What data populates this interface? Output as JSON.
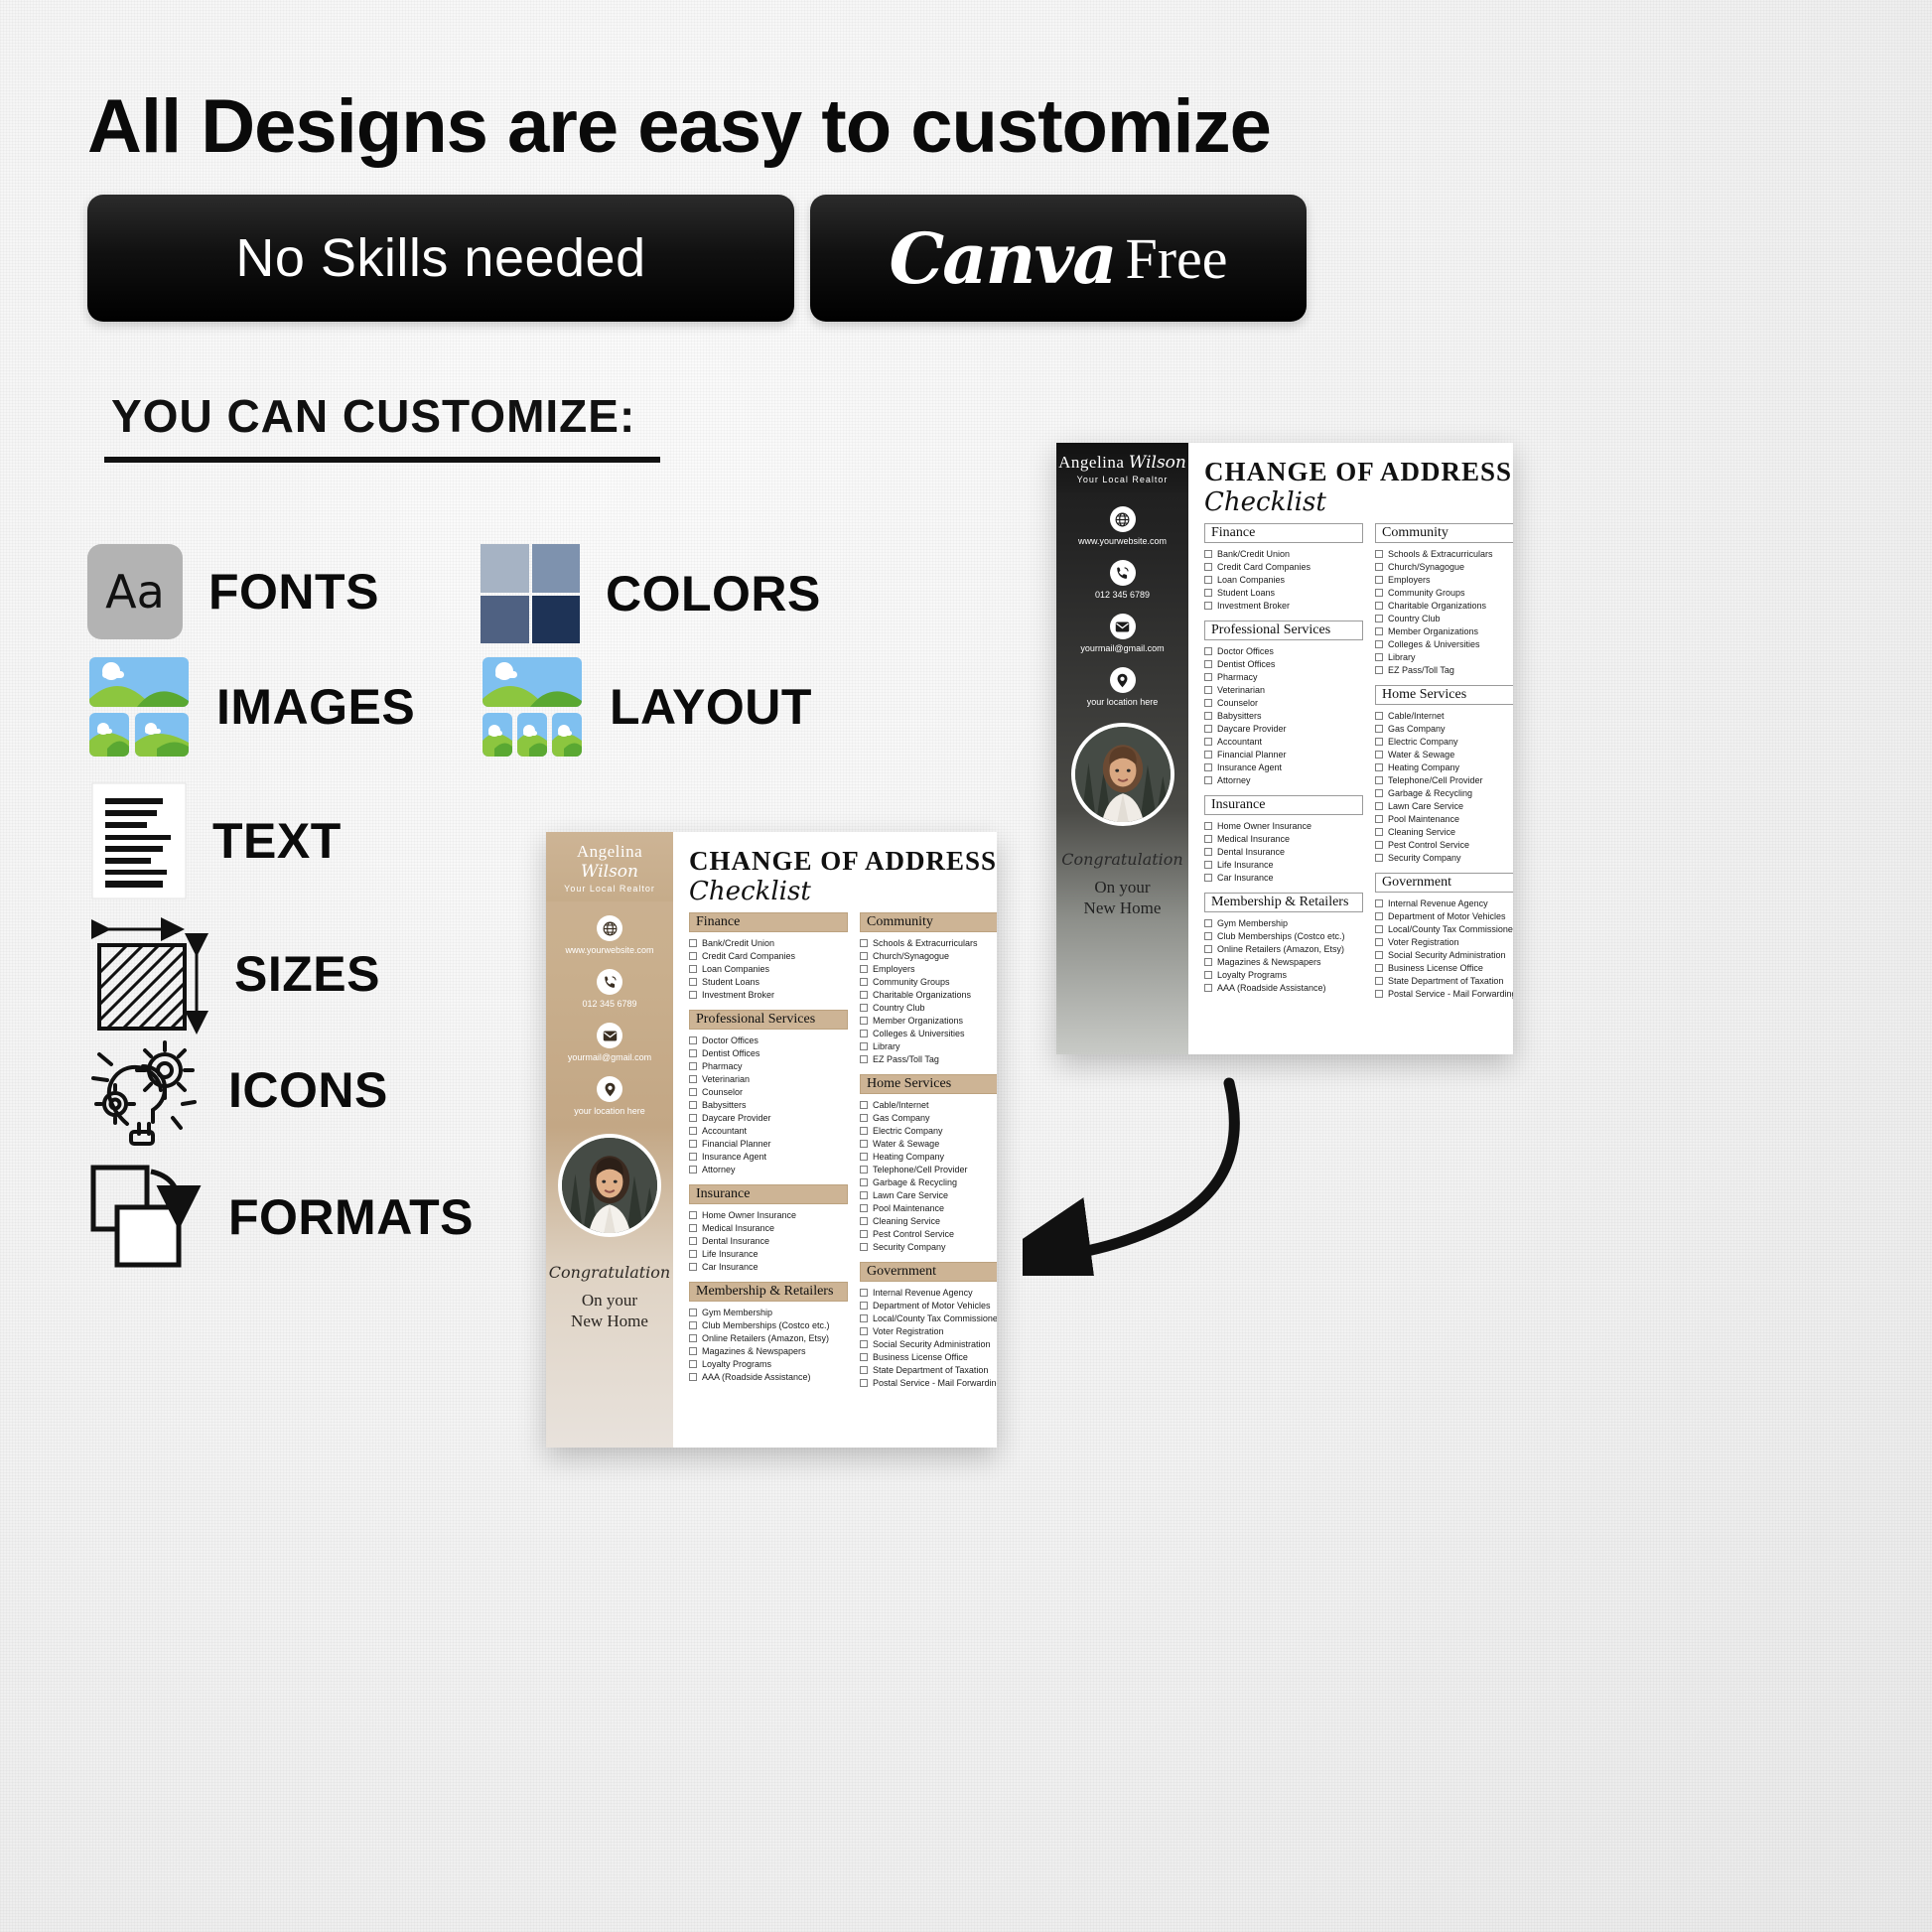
{
  "headline": "All Designs are easy to customize",
  "badges": {
    "no_skills": "No Skills needed",
    "canva_word": "Canva",
    "canva_free": "Free"
  },
  "customize": {
    "heading": "YOU CAN CUSTOMIZE:",
    "features": [
      {
        "label": "FONTS",
        "icon": "fonts-icon",
        "sample": "Aa"
      },
      {
        "label": "COLORS",
        "icon": "colors-swatch-icon"
      },
      {
        "label": "IMAGES",
        "icon": "images-icon"
      },
      {
        "label": "LAYOUT",
        "icon": "layout-icon"
      },
      {
        "label": "TEXT",
        "icon": "text-document-icon"
      },
      {
        "label": "SIZES",
        "icon": "sizes-dimension-icon"
      },
      {
        "label": "ICONS",
        "icon": "lightbulb-gear-icon"
      },
      {
        "label": "FORMATS",
        "icon": "formats-swap-icon"
      }
    ]
  },
  "colors": {
    "swatch": [
      "#a6b3c4",
      "#7e92ae",
      "#4f6182",
      "#1e3356"
    ],
    "fonts_icon_bg": "#b3b3b3",
    "badge_bg": "#000000",
    "flyer_front_accent": "#c6ac8a",
    "flyer_back_accent": "#1e1e1e"
  },
  "arrow": {
    "icon": "curved-arrow-icon"
  },
  "flyer": {
    "brand": {
      "first_name": "Angelina",
      "last_name": "Wilson",
      "tagline": "Your Local Realtor"
    },
    "contacts": [
      {
        "icon": "globe-icon",
        "text": "www.yourwebsite.com"
      },
      {
        "icon": "phone-icon",
        "text": "012 345 6789"
      },
      {
        "icon": "envelope-icon",
        "text": "yourmail@gmail.com"
      },
      {
        "icon": "location-pin-icon",
        "text": "your location here"
      }
    ],
    "portrait": {
      "icon": "realtor-portrait"
    },
    "congratulation": "Congratulation",
    "new_home_line1": "On your",
    "new_home_line2": "New Home",
    "title": "CHANGE OF ADDRESS",
    "subtitle": "Checklist",
    "left_column": [
      {
        "heading": "Finance",
        "items": [
          "Bank/Credit Union",
          "Credit Card Companies",
          "Loan Companies",
          "Student Loans",
          "Investment Broker"
        ]
      },
      {
        "heading": "Professional Services",
        "items": [
          "Doctor Offices",
          "Dentist Offices",
          "Pharmacy",
          "Veterinarian",
          "Counselor",
          "Babysitters",
          "Daycare Provider",
          "Accountant",
          "Financial Planner",
          "Insurance Agent",
          "Attorney"
        ]
      },
      {
        "heading": "Insurance",
        "items": [
          "Home Owner Insurance",
          "Medical Insurance",
          "Dental Insurance",
          "Life Insurance",
          "Car Insurance"
        ]
      },
      {
        "heading": "Membership & Retailers",
        "items": [
          "Gym Membership",
          "Club Memberships (Costco etc.)",
          "Online Retailers (Amazon, Etsy)",
          "Magazines & Newspapers",
          "Loyalty Programs",
          "AAA (Roadside Assistance)"
        ]
      }
    ],
    "right_column": [
      {
        "heading": "Community",
        "items": [
          "Schools & Extracurriculars",
          "Church/Synagogue",
          "Employers",
          "Community Groups",
          "Charitable Organizations",
          "Country Club",
          "Member Organizations",
          "Colleges & Universities",
          "Library",
          "EZ Pass/Toll Tag"
        ]
      },
      {
        "heading": "Home Services",
        "items": [
          "Cable/Internet",
          "Gas Company",
          "Electric Company",
          "Water & Sewage",
          "Heating Company",
          "Telephone/Cell Provider",
          "Garbage & Recycling",
          "Lawn Care Service",
          "Pool Maintenance",
          "Cleaning Service",
          "Pest Control Service",
          "Security Company"
        ]
      },
      {
        "heading": "Government",
        "items": [
          "Internal Revenue Agency",
          "Department of Motor Vehicles",
          "Local/County Tax Commissioner",
          "Voter Registration",
          "Social Security Administration",
          "Business License Office",
          "State Department of Taxation",
          "Postal Service - Mail Forwarding"
        ]
      }
    ]
  }
}
